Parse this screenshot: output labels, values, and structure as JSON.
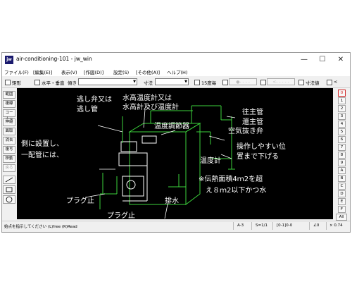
{
  "window": {
    "app_icon_text": "jw",
    "title": "air-conditioning-101 - jw_win",
    "minimize": "—",
    "maximize": "☐",
    "close": "✕"
  },
  "menu": [
    "ファイル(F)",
    "[編集(E)]",
    "表示(V)",
    "[作図(D)]",
    "設定(S)",
    "[その他(A)]",
    "ヘルプ(H)"
  ],
  "toolbar": {
    "rect_label": "矩形",
    "hv_label": "水平・垂直",
    "slope_label": "傾き",
    "slope_value": "",
    "size_label": "寸法",
    "size_value": "",
    "deg15_label": "15度毎",
    "line_btn1": "●- - - -",
    "line_btn2": "<- - - - -",
    "dim_label": "寸法値",
    "arrow_label": "<"
  },
  "left_tools": [
    "範囲",
    "複線",
    "コーナー",
    "伸縮",
    "面取",
    "消去",
    "複写",
    "移動",
    "戻る"
  ],
  "right_tools": [
    "0",
    "1",
    "2",
    "3",
    "4",
    "5",
    "6",
    "7",
    "8",
    "9",
    "A",
    "B",
    "C",
    "D",
    "E",
    "F"
  ],
  "right_extra": [
    "All",
    "×",
    "0",
    "1",
    "2"
  ],
  "drawing": {
    "labels": {
      "relief_valve": "逃し弁又は",
      "relief_pipe": "逃し管",
      "gauge1": "水高温度計又は",
      "gauge2": "水高計及び温度計",
      "temp_controller": "温度調節器",
      "outgoing": "往主管",
      "return": "還主管",
      "air_vent": "空気抜き弁",
      "note1": "操作しやすい位",
      "note2": "置まで下げる",
      "thermometer": "温度計",
      "left1": "側に設置し、",
      "left2": "一配管には、",
      "area1": "※伝熱面積4ｍ2を超",
      "area2": "え８ｍ2以下かつ水",
      "plug1": "プラグ止",
      "plug2": "プラグ止",
      "drain": "排水"
    }
  },
  "status": {
    "prompt": "始点を指示してください (L)free (R)Read",
    "paper": "A-3",
    "scale": "S=1/1",
    "layer": "[0-1]0-0",
    "angle": "∠0",
    "zoom": "× 0.74"
  }
}
